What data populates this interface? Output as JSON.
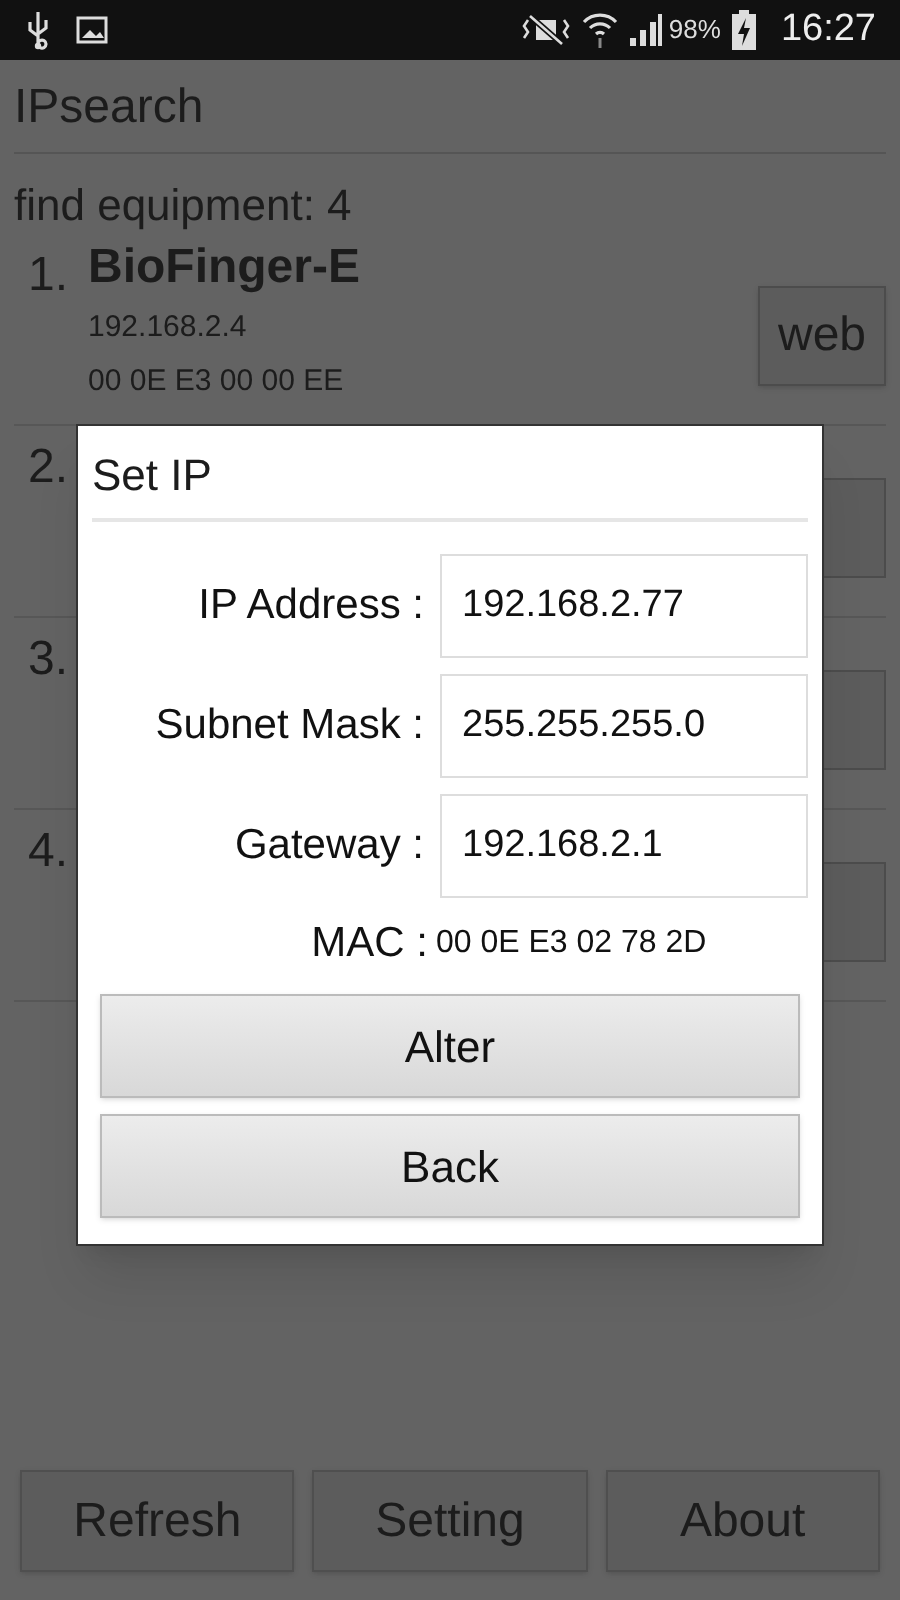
{
  "status_bar": {
    "battery": "98%",
    "time": "16:27"
  },
  "app": {
    "title": "IPsearch",
    "count_label": "find equipment: 4"
  },
  "devices": [
    {
      "number": "1.",
      "name": "BioFinger-E",
      "ip": "192.168.2.4",
      "mac": "00 0E E3 00 00 EE",
      "button": "web"
    },
    {
      "number": "2."
    },
    {
      "number": "3."
    },
    {
      "number": "4."
    }
  ],
  "dialog": {
    "title": "Set IP",
    "fields": [
      {
        "label": "IP Address :",
        "value": "192.168.2.77"
      },
      {
        "label": "Subnet Mask :",
        "value": "255.255.255.0"
      },
      {
        "label": "Gateway :",
        "value": "192.168.2.1"
      }
    ],
    "mac_label": "MAC :",
    "mac_value": "00 0E E3 02 78 2D",
    "buttons": [
      "Alter",
      "Back"
    ]
  },
  "bottom_buttons": [
    "Refresh",
    "Setting",
    "About"
  ]
}
